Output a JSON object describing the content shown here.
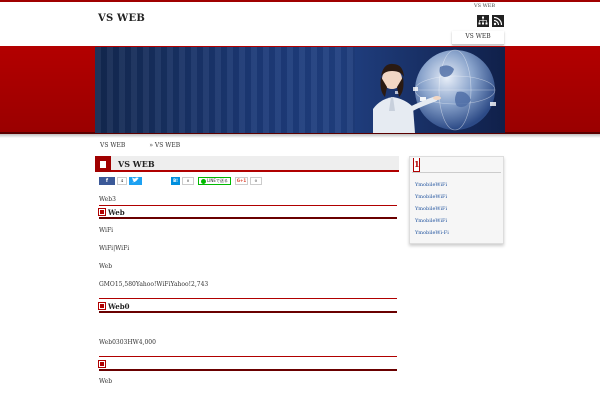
{
  "header": {
    "site_title": "VS WEB",
    "top_label": "VS WEB",
    "nav_item": "VS WEB",
    "icons": [
      "sitemap-icon",
      "rss-icon"
    ]
  },
  "breadcrumb": [
    "VS WEB",
    "»  VS WEB"
  ],
  "post": {
    "title": "VS WEB",
    "share": {
      "facebook_count": "4",
      "hatena_count": "0",
      "line_label": "LINEで送る",
      "gplus_label": "G+1",
      "gplus_count": "0"
    },
    "intro": "Web3",
    "sections": [
      {
        "heading": "Web",
        "paragraphs": [
          "WiFi",
          "WiFi|WiFi",
          "Web",
          "GMO15,580Yahoo!WiFiYahoo!2,743"
        ]
      },
      {
        "heading": "Web0",
        "paragraphs": [
          "Web0303HW4,000"
        ]
      },
      {
        "heading": "",
        "paragraphs": [
          "Web"
        ]
      }
    ]
  },
  "sidebar": {
    "tab_label": "1",
    "links": [
      "YmobileWiFi",
      "YmobileWiFi",
      "YmobileWiFi",
      "YmobileWiFi",
      "YmobileWi-Fi"
    ]
  },
  "colors": {
    "accent": "#a00000",
    "link": "#1a4e9b",
    "hero_blue": "#1c3a78"
  }
}
